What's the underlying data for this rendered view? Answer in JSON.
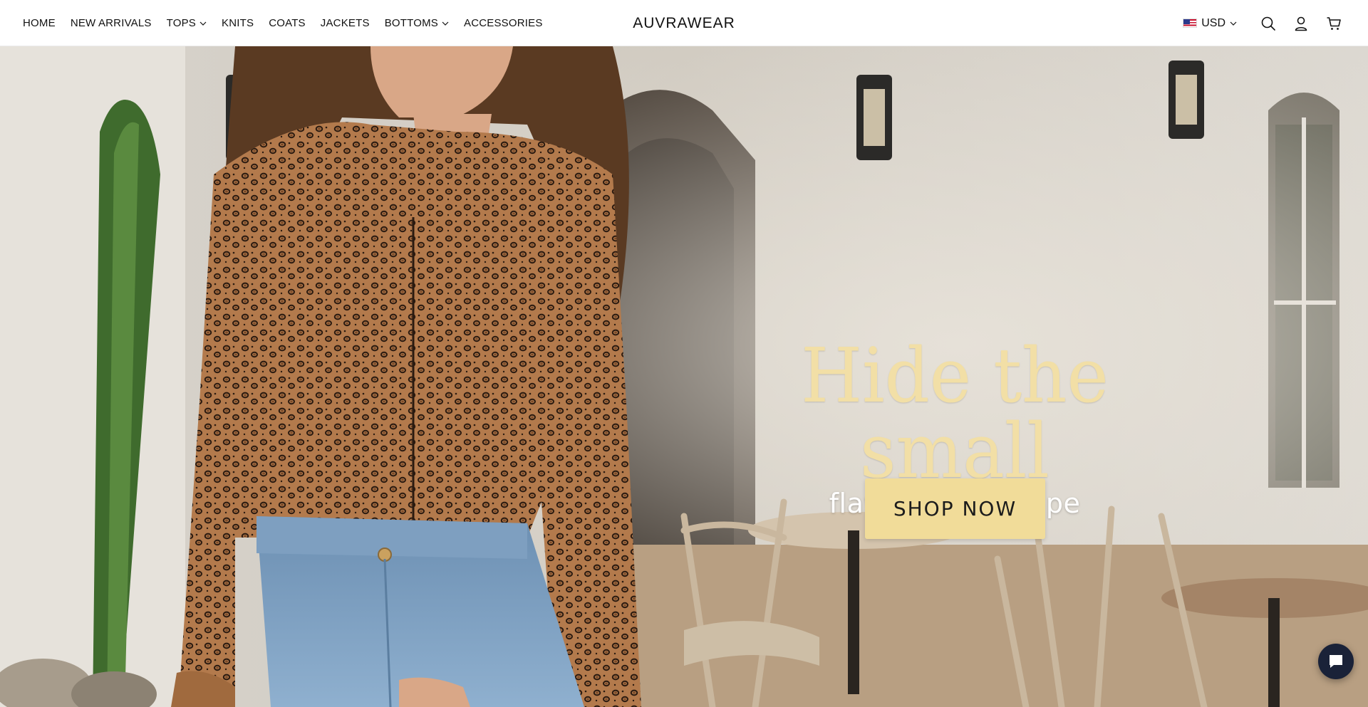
{
  "header": {
    "nav": [
      {
        "label": "HOME",
        "has_dropdown": false
      },
      {
        "label": "NEW ARRIVALS",
        "has_dropdown": false
      },
      {
        "label": "TOPS",
        "has_dropdown": true
      },
      {
        "label": "KNITS",
        "has_dropdown": false
      },
      {
        "label": "COATS",
        "has_dropdown": false
      },
      {
        "label": "JACKETS",
        "has_dropdown": false
      },
      {
        "label": "BOTTOMS",
        "has_dropdown": true
      },
      {
        "label": "ACCESSORIES",
        "has_dropdown": false
      }
    ],
    "logo": "AUVRAWEAR",
    "currency": {
      "code": "USD",
      "flag_icon": "us-flag-icon"
    },
    "icons": [
      "search-icon",
      "account-icon",
      "cart-icon"
    ]
  },
  "hero": {
    "headline": "Hide the small",
    "subheadline": "flaws of leg shape",
    "cta_label": "SHOP NOW",
    "colors": {
      "headline": "#f2dfa6",
      "cta_background": "#f1dc99",
      "subheadline": "#ffffff"
    }
  },
  "chat": {
    "icon": "chat-bubble-icon",
    "background": "#1a2238"
  }
}
